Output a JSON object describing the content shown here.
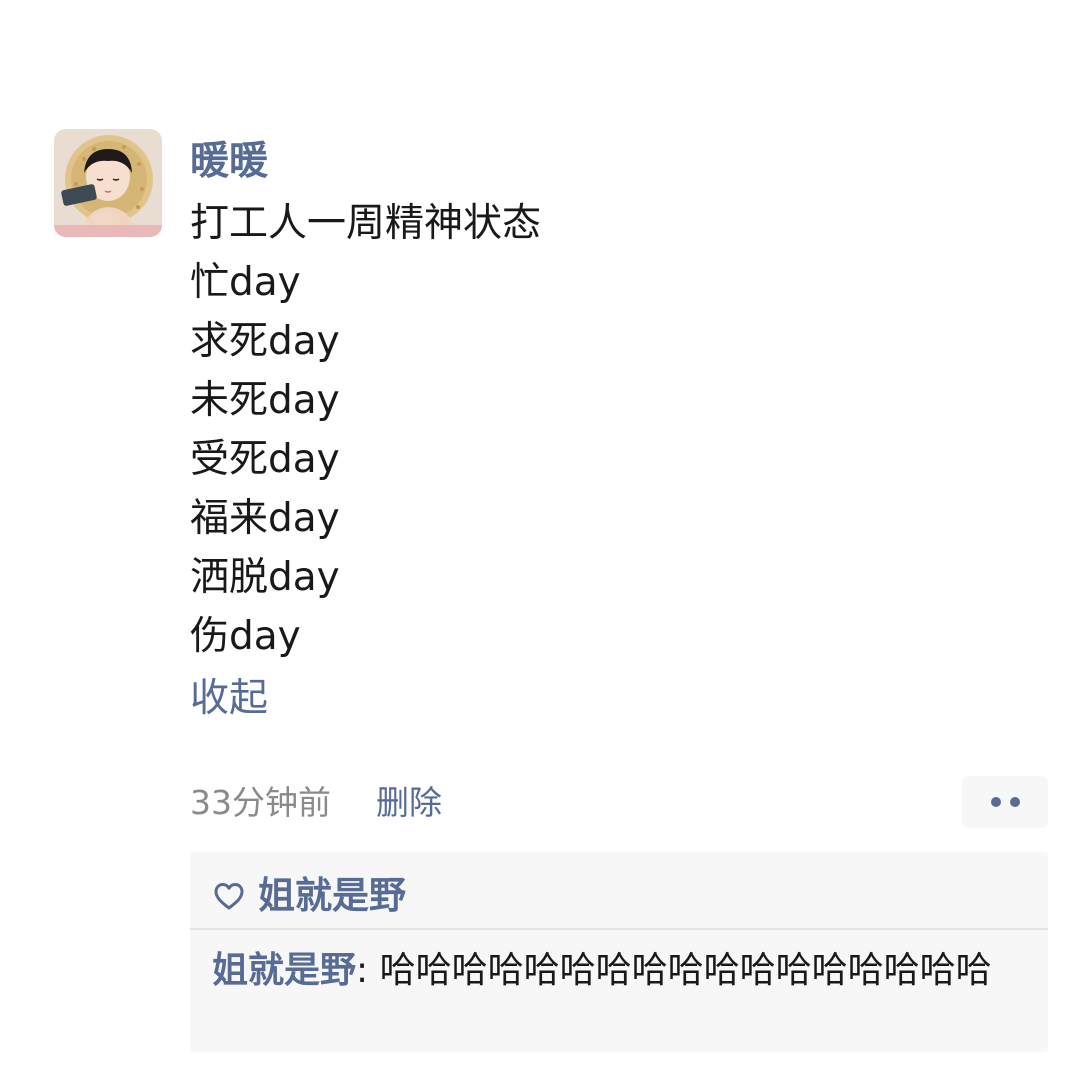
{
  "post": {
    "author_name": "暖暖",
    "lines": [
      "打工人一周精神状态",
      "忙day",
      "求死day",
      "未死day",
      "受死day",
      "福来day",
      "洒脱day",
      "伤day"
    ],
    "collapse_label": "收起",
    "time_ago": "33分钟前",
    "delete_label": "删除"
  },
  "likes": {
    "users": [
      "姐就是野"
    ]
  },
  "comments": [
    {
      "author": "姐就是野",
      "separator": ": ",
      "text": "哈哈哈哈哈哈哈哈哈哈哈哈哈哈哈哈哈"
    }
  ],
  "colors": {
    "link_blue": "#576b95",
    "meta_gray": "#8a8a8a",
    "panel_bg": "#f7f7f7"
  },
  "icons": {
    "more": "more-dots-icon",
    "like": "heart-outline-icon",
    "avatar": "avatar-photo"
  }
}
